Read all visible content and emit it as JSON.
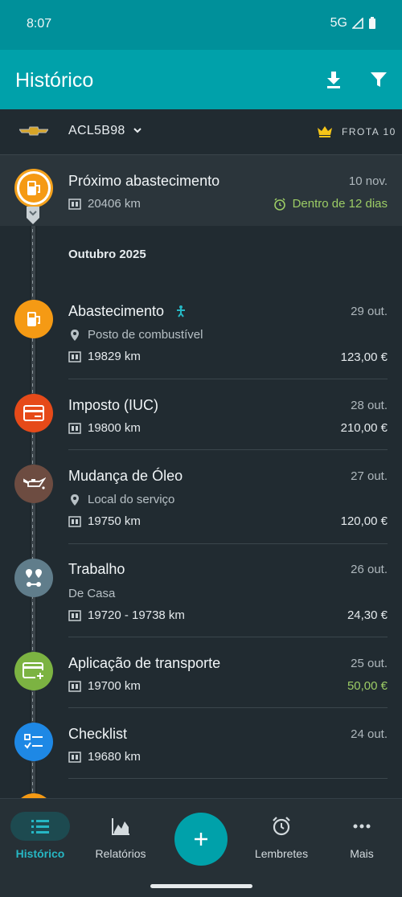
{
  "status": {
    "time": "8:07",
    "network": "5G"
  },
  "appbar": {
    "title": "Histórico"
  },
  "vehicle": {
    "plate": "ACL5B98",
    "fleet_label": "FROTA 10"
  },
  "next_refuel": {
    "title": "Próximo abastecimento",
    "date": "10 nov.",
    "odometer": "20406 km",
    "reminder": "Dentro de 12 dias"
  },
  "month": "Outubro 2025",
  "items": [
    {
      "title": "Abastecimento",
      "date": "29 out.",
      "place": "Posto de combustível",
      "odometer": "19829 km",
      "amount": "123,00 €",
      "color": "#f59a14"
    },
    {
      "title": "Imposto (IUC)",
      "date": "28 out.",
      "odometer": "19800 km",
      "amount": "210,00 €",
      "color": "#e64a19"
    },
    {
      "title": "Mudança de Óleo",
      "date": "27 out.",
      "place": "Local do serviço",
      "odometer": "19750 km",
      "amount": "120,00 €",
      "color": "#6d4c41"
    },
    {
      "title": "Trabalho",
      "date": "26 out.",
      "route": "De Casa",
      "odometer": "19720 - 19738 km",
      "amount": "24,30 €",
      "color": "#607d8b"
    },
    {
      "title": "Aplicação de transporte",
      "date": "25 out.",
      "odometer": "19700 km",
      "amount": "50,00 €",
      "color": "#7cb342"
    },
    {
      "title": "Checklist",
      "date": "24 out.",
      "odometer": "19680 km",
      "color": "#1e88e5"
    }
  ],
  "nav": {
    "historico": "Histórico",
    "relatorios": "Relatórios",
    "lembretes": "Lembretes",
    "mais": "Mais"
  }
}
